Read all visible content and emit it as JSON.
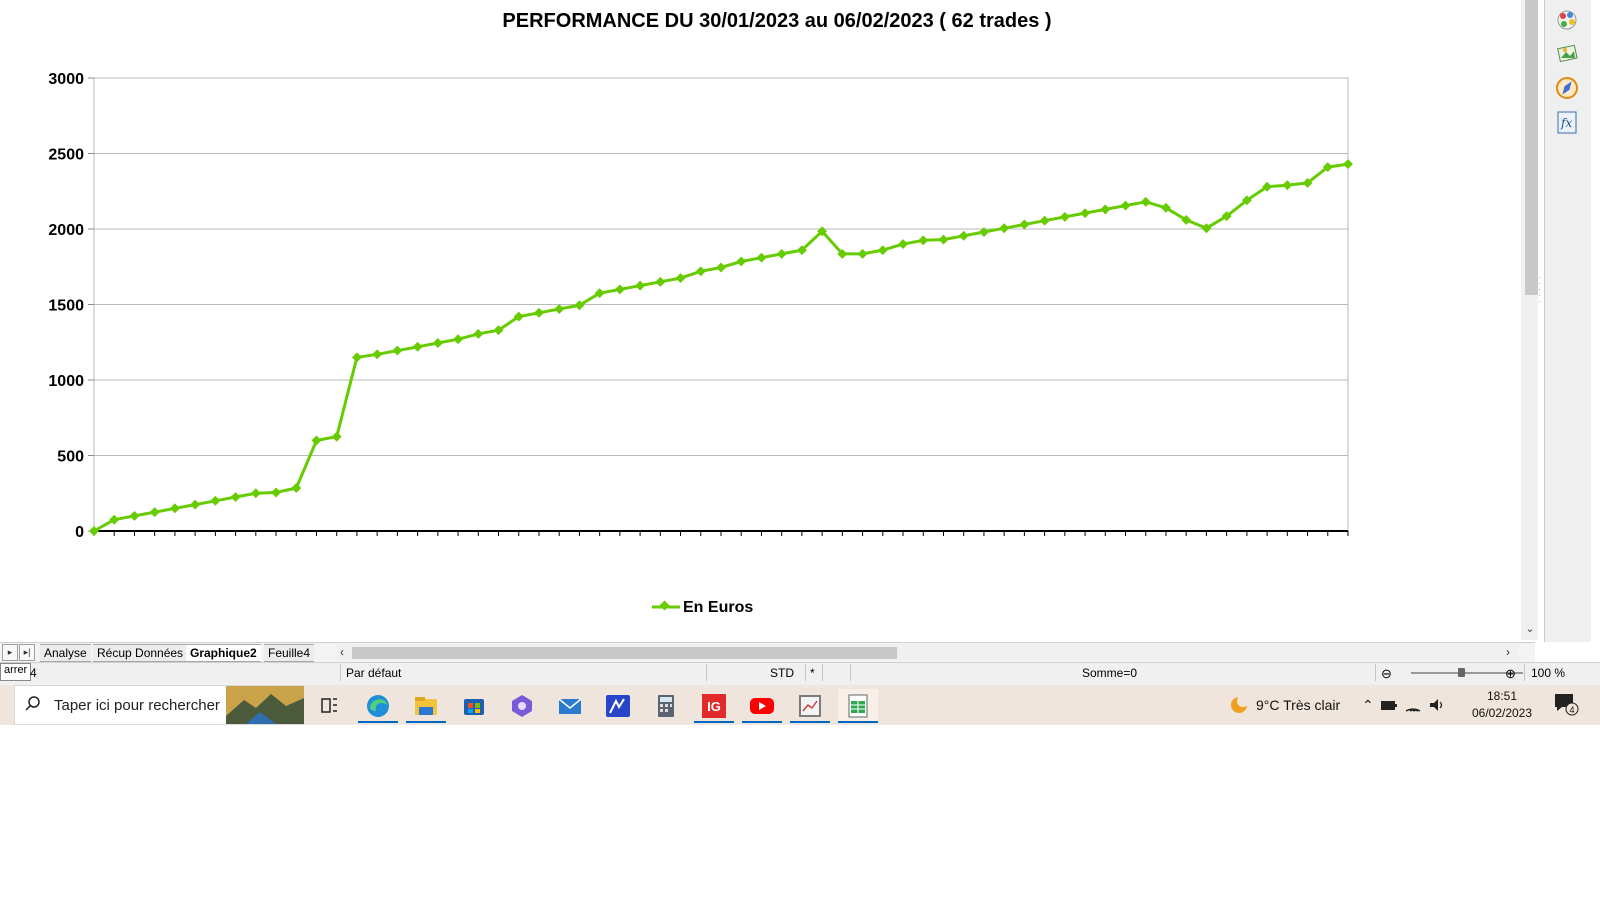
{
  "chart_data": {
    "type": "line",
    "title": "PERFORMANCE DU 30/01/2023 au 06/02/2023 ( 62 trades )",
    "ylim": [
      0,
      3000
    ],
    "yticks": [
      "0",
      "500",
      "1000",
      "1500",
      "2000",
      "2500",
      "3000"
    ],
    "grid": true,
    "legend_position": "bottom",
    "series": [
      {
        "name": "En Euros",
        "color": "#66cc00",
        "marker": "diamond",
        "values": [
          0,
          75,
          100,
          125,
          150,
          175,
          200,
          225,
          250,
          255,
          285,
          600,
          625,
          1150,
          1170,
          1195,
          1220,
          1245,
          1270,
          1305,
          1330,
          1420,
          1445,
          1470,
          1495,
          1575,
          1600,
          1625,
          1650,
          1675,
          1720,
          1745,
          1785,
          1810,
          1835,
          1860,
          1985,
          1835,
          1835,
          1860,
          1900,
          1925,
          1930,
          1955,
          1980,
          2005,
          2030,
          2055,
          2080,
          2105,
          2130,
          2155,
          2180,
          2140,
          2060,
          2005,
          2085,
          2190,
          2280,
          2290,
          2305,
          2410,
          2430
        ]
      }
    ]
  },
  "sidebar": {
    "icons": [
      "styles-icon",
      "gallery-icon",
      "navigator-icon",
      "function-wizard-icon"
    ]
  },
  "tabs": {
    "items": [
      {
        "label": "Analyse",
        "active": false
      },
      {
        "label": "Récup Données",
        "active": false
      },
      {
        "label": "Graphique2",
        "active": true
      },
      {
        "label": "Feuille4",
        "active": false
      }
    ]
  },
  "statusbar": {
    "tooltip": "arrer",
    "sheet_fragment": "4",
    "page_style": "Par défaut",
    "mode": "STD",
    "modified": "*",
    "sum": "Somme=0",
    "zoom": "100 %"
  },
  "taskbar": {
    "search_placeholder": "Taper ici pour rechercher",
    "apps": [
      "task-view-icon",
      "edge-icon",
      "file-explorer-icon",
      "store-icon",
      "copilot-icon",
      "mail-icon",
      "trading-app-icon",
      "calculator-icon",
      "ig-icon",
      "youtube-icon",
      "chart-app-icon",
      "calc-spreadsheet-icon"
    ],
    "ig_label": "IG",
    "weather": "9°C  Très clair",
    "time": "18:51",
    "date": "06/02/2023",
    "notifications": "4"
  }
}
